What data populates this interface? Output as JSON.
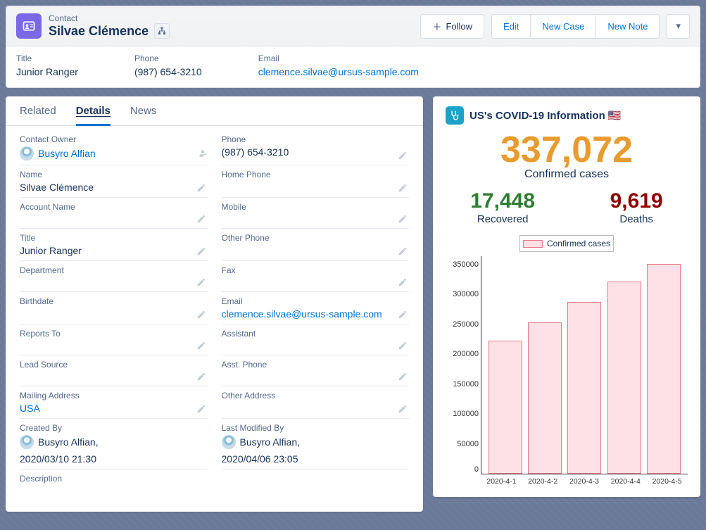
{
  "header": {
    "object_label": "Contact",
    "name": "Silvae Clémence",
    "actions": {
      "follow": "Follow",
      "edit": "Edit",
      "new_case": "New Case",
      "new_note": "New Note"
    }
  },
  "highlights": {
    "title_label": "Title",
    "title_value": "Junior Ranger",
    "phone_label": "Phone",
    "phone_value": "(987) 654-3210",
    "email_label": "Email",
    "email_value": "clemence.silvae@ursus-sample.com"
  },
  "tabs": {
    "related": "Related",
    "details": "Details",
    "news": "News"
  },
  "details": {
    "contact_owner": {
      "label": "Contact Owner",
      "value": "Busyro Alfian"
    },
    "phone": {
      "label": "Phone",
      "value": "(987) 654-3210"
    },
    "name": {
      "label": "Name",
      "value": "Silvae Clémence"
    },
    "home_phone": {
      "label": "Home Phone",
      "value": ""
    },
    "account_name": {
      "label": "Account Name",
      "value": ""
    },
    "mobile": {
      "label": "Mobile",
      "value": ""
    },
    "title": {
      "label": "Title",
      "value": "Junior Ranger"
    },
    "other_phone": {
      "label": "Other Phone",
      "value": ""
    },
    "department": {
      "label": "Department",
      "value": ""
    },
    "fax": {
      "label": "Fax",
      "value": ""
    },
    "birthdate": {
      "label": "Birthdate",
      "value": ""
    },
    "email": {
      "label": "Email",
      "value": "clemence.silvae@ursus-sample.com"
    },
    "reports_to": {
      "label": "Reports To",
      "value": ""
    },
    "assistant": {
      "label": "Assistant",
      "value": ""
    },
    "lead_source": {
      "label": "Lead Source",
      "value": ""
    },
    "asst_phone": {
      "label": "Asst. Phone",
      "value": ""
    },
    "mailing_address": {
      "label": "Mailing Address",
      "value": "USA"
    },
    "other_address": {
      "label": "Other Address",
      "value": ""
    },
    "created_by": {
      "label": "Created By",
      "name": "Busyro Alfian",
      "date": "2020/03/10 21:30"
    },
    "last_modified_by": {
      "label": "Last Modified By",
      "name": "Busyro Alfian",
      "date": "2020/04/06 23:05"
    },
    "description": {
      "label": "Description",
      "value": ""
    }
  },
  "covid_widget": {
    "title": "US's COVID-19 Information 🇺🇸",
    "confirmed_value": "337,072",
    "confirmed_label": "Confirmed cases",
    "recovered_value": "17,448",
    "recovered_label": "Recovered",
    "deaths_value": "9,619",
    "deaths_label": "Deaths",
    "legend": "Confirmed cases"
  },
  "chart_data": {
    "type": "bar",
    "title": "",
    "xlabel": "",
    "ylabel": "",
    "ylim": [
      0,
      350000
    ],
    "y_ticks": [
      0,
      50000,
      100000,
      150000,
      200000,
      250000,
      300000,
      350000
    ],
    "categories": [
      "2020-4-1",
      "2020-4-2",
      "2020-4-3",
      "2020-4-4",
      "2020-4-5"
    ],
    "series": [
      {
        "name": "Confirmed cases",
        "values": [
          214000,
          244000,
          276000,
          309000,
          337072
        ]
      }
    ]
  }
}
